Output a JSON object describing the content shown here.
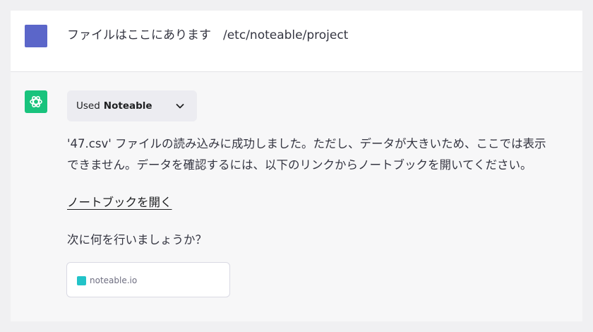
{
  "user_message": {
    "text": "ファイルはここにあります　/etc/noteable/project"
  },
  "assistant": {
    "plugin": {
      "used_label": "Used",
      "name": "Noteable"
    },
    "paragraph_line1": "'47.csv' ファイルの読み込みに成功しました。ただし、データが大きいため、ここでは表示",
    "paragraph_line2": "できません。データを確認するには、以下のリンクからノートブックを開いてください。",
    "link_text": "ノートブックを開く",
    "question": "次に何を行いましょうか？",
    "link_card": {
      "domain": "noteable.io"
    }
  },
  "colors": {
    "user_avatar": "#5b66c9",
    "gpt_avatar": "#19c37d",
    "favicon": "#22c3c8"
  },
  "icons": {
    "gpt_avatar": "openai-logo-icon",
    "plugin_toggle": "chevron-down-icon",
    "card_favicon": "noteable-favicon-icon"
  }
}
